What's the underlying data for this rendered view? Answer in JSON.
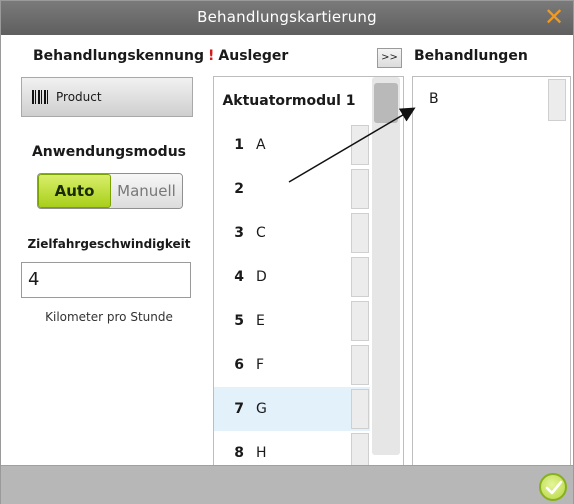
{
  "window": {
    "title": "Behandlungskartierung"
  },
  "headers": {
    "left": "Behandlungskennung",
    "mid_marker": "!",
    "mid": "Ausleger",
    "move_button": ">>",
    "right": "Behandlungen"
  },
  "left_panel": {
    "product_button": "Product",
    "mode_label": "Anwendungsmodus",
    "mode_options": [
      "Auto",
      "Manuell"
    ],
    "mode_selected": "Auto",
    "speed_label": "Zielfahrgeschwindigkeit",
    "speed_value": "4",
    "speed_unit": "Kilometer pro Stunde"
  },
  "boom": {
    "title": "Aktuatormodul 1",
    "rows": [
      {
        "num": "1",
        "value": "A"
      },
      {
        "num": "2",
        "value": ""
      },
      {
        "num": "3",
        "value": "C"
      },
      {
        "num": "4",
        "value": "D"
      },
      {
        "num": "5",
        "value": "E"
      },
      {
        "num": "6",
        "value": "F"
      },
      {
        "num": "7",
        "value": "G"
      },
      {
        "num": "8",
        "value": "H"
      }
    ],
    "selected_row": "7"
  },
  "treatments": {
    "items": [
      "B"
    ]
  },
  "colors": {
    "accent_green": "#a8cf1a",
    "close_orange": "#f39a1e",
    "warning_red": "#d21a1a",
    "selected_row": "#e3f1fb"
  },
  "icons": {
    "close": "close-x-icon",
    "product": "barcode-icon",
    "confirm": "check-circle-icon"
  }
}
